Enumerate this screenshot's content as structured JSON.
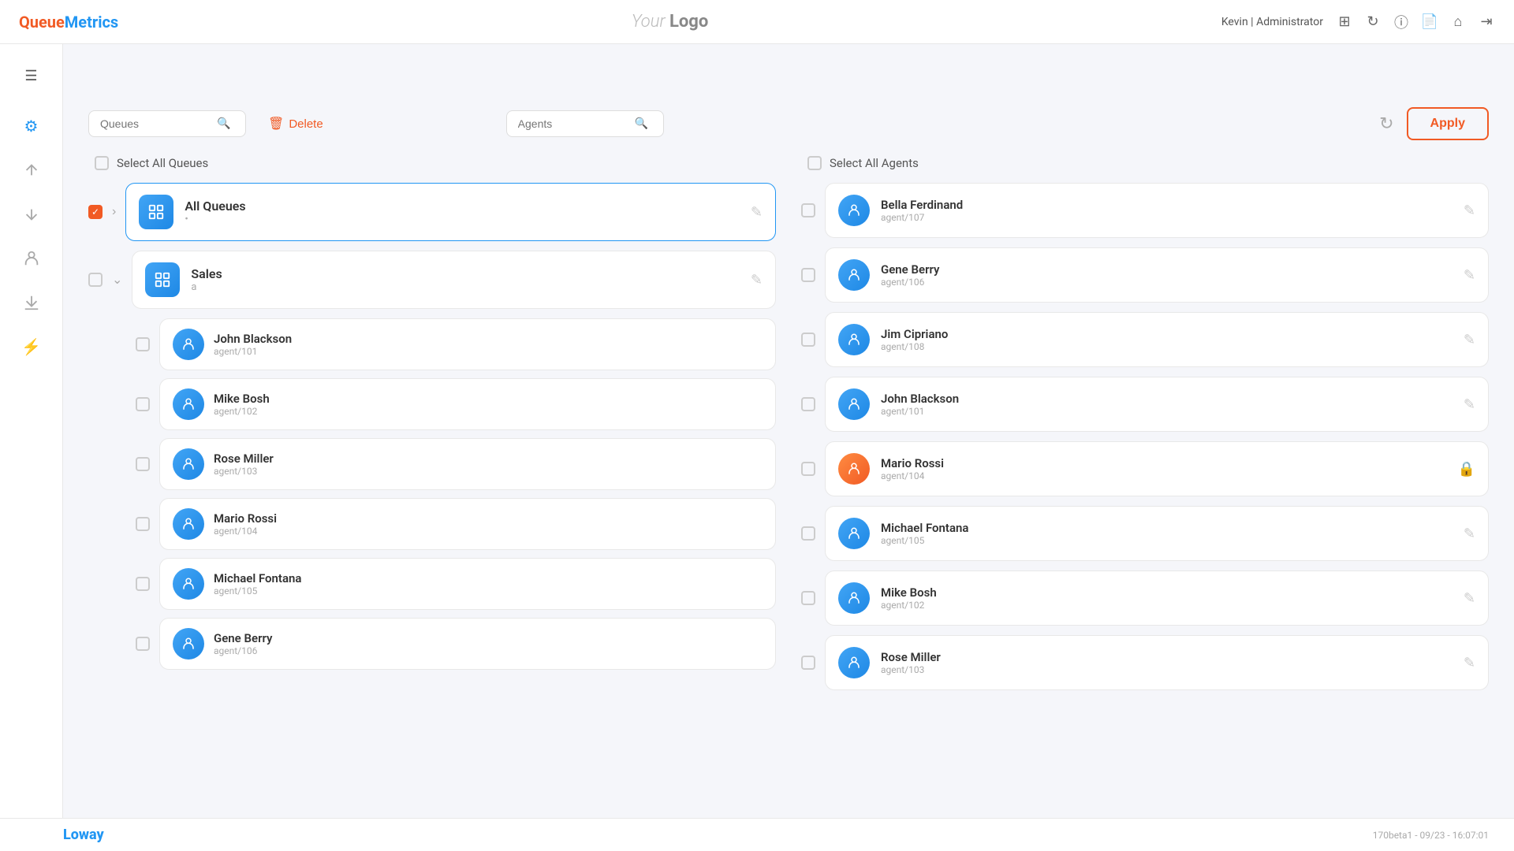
{
  "header": {
    "logo_queue": "Queue",
    "logo_metrics": "Metrics",
    "your_logo": "Your Logo",
    "user": "Kevin",
    "role": "Administrator"
  },
  "header_icons": [
    "grid-icon",
    "refresh-icon",
    "info-icon",
    "document-icon",
    "home-icon",
    "logout-icon"
  ],
  "sidebar": {
    "hamburger": "☰",
    "items": [
      {
        "name": "settings-icon",
        "icon": "⚙"
      },
      {
        "name": "upload-icon",
        "icon": "↑"
      },
      {
        "name": "download-icon",
        "icon": "↓"
      },
      {
        "name": "user-icon",
        "icon": "👤"
      },
      {
        "name": "export-icon",
        "icon": "⬇"
      },
      {
        "name": "flash-icon",
        "icon": "⚡"
      }
    ]
  },
  "toolbar": {
    "queues_placeholder": "Queues",
    "agents_placeholder": "Agents",
    "delete_label": "Delete",
    "apply_label": "Apply"
  },
  "queues_panel": {
    "select_all_label": "Select All Queues",
    "queues": [
      {
        "id": "all",
        "name": "All Queues",
        "sub": "•",
        "selected": true,
        "expanded": true
      },
      {
        "id": "sales",
        "name": "Sales",
        "sub": "a",
        "selected": false,
        "expanded": true
      }
    ],
    "sub_agents": [
      {
        "name": "John Blackson",
        "id": "agent/101"
      },
      {
        "name": "Mike Bosh",
        "id": "agent/102"
      },
      {
        "name": "Rose Miller",
        "id": "agent/103"
      },
      {
        "name": "Mario Rossi",
        "id": "agent/104"
      },
      {
        "name": "Michael Fontana",
        "id": "agent/105"
      },
      {
        "name": "Gene Berry",
        "id": "agent/106"
      }
    ]
  },
  "agents_panel": {
    "select_all_label": "Select All Agents",
    "agents": [
      {
        "name": "Bella Ferdinand",
        "id": "agent/107",
        "locked": false,
        "orange": false
      },
      {
        "name": "Gene Berry",
        "id": "agent/106",
        "locked": false,
        "orange": false
      },
      {
        "name": "Jim Cipriano",
        "id": "agent/108",
        "locked": false,
        "orange": false
      },
      {
        "name": "John Blackson",
        "id": "agent/101",
        "locked": false,
        "orange": false
      },
      {
        "name": "Mario Rossi",
        "id": "agent/104",
        "locked": true,
        "orange": true
      },
      {
        "name": "Michael Fontana",
        "id": "agent/105",
        "locked": false,
        "orange": false
      },
      {
        "name": "Mike Bosh",
        "id": "agent/102",
        "locked": false,
        "orange": false
      },
      {
        "name": "Rose Miller",
        "id": "agent/103",
        "locked": false,
        "orange": false
      }
    ]
  },
  "footer": {
    "logo": "Loway",
    "version": "170beta1 - 09/23 - 16:07:01"
  }
}
